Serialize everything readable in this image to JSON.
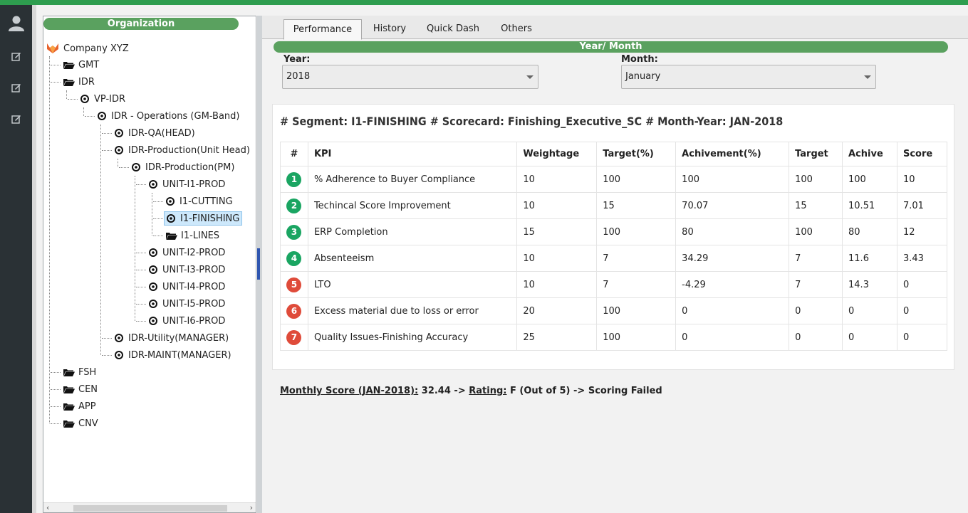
{
  "org_header": "Organization",
  "tree": {
    "root": "Company XYZ",
    "items": [
      {
        "label": "GMT"
      },
      {
        "label": "IDR"
      },
      {
        "label": "VP-IDR"
      },
      {
        "label": "IDR - Operations (GM-Band)"
      },
      {
        "label": "IDR-QA(HEAD)"
      },
      {
        "label": "IDR-Production(Unit Head)"
      },
      {
        "label": "IDR-Production(PM)"
      },
      {
        "label": "UNIT-I1-PROD"
      },
      {
        "label": "I1-CUTTING"
      },
      {
        "label": "I1-FINISHING"
      },
      {
        "label": "I1-LINES"
      },
      {
        "label": "UNIT-I2-PROD"
      },
      {
        "label": "UNIT-I3-PROD"
      },
      {
        "label": "UNIT-I4-PROD"
      },
      {
        "label": "UNIT-I5-PROD"
      },
      {
        "label": "UNIT-I6-PROD"
      },
      {
        "label": "IDR-Utility(MANAGER)"
      },
      {
        "label": "IDR-MAINT(MANAGER)"
      },
      {
        "label": "FSH"
      },
      {
        "label": "CEN"
      },
      {
        "label": "APP"
      },
      {
        "label": "CNV"
      }
    ],
    "selected": "I1-FINISHING"
  },
  "tabs": [
    "Performance",
    "History",
    "Quick Dash",
    "Others"
  ],
  "active_tab": "Performance",
  "year_month": {
    "header": "Year/ Month",
    "year_label": "Year:",
    "year_value": "2018",
    "month_label": "Month:",
    "month_value": "January"
  },
  "card": {
    "title": "# Segment: I1-FINISHING # Scorecard: Finishing_Executive_SC # Month-Year: JAN-2018",
    "columns": [
      "#",
      "KPI",
      "Weightage",
      "Target(%)",
      "Achivement(%)",
      "Target",
      "Achive",
      "Score"
    ],
    "rows": [
      {
        "n": "1",
        "status": "green",
        "kpi": "% Adherence to Buyer Compliance",
        "weightage": "10",
        "target_pct": "100",
        "achievement_pct": "100",
        "target": "100",
        "achive": "100",
        "score": "10"
      },
      {
        "n": "2",
        "status": "green",
        "kpi": "Techincal Score Improvement",
        "weightage": "10",
        "target_pct": "15",
        "achievement_pct": "70.07",
        "target": "15",
        "achive": "10.51",
        "score": "7.01"
      },
      {
        "n": "3",
        "status": "green",
        "kpi": "ERP Completion",
        "weightage": "15",
        "target_pct": "100",
        "achievement_pct": "80",
        "target": "100",
        "achive": "80",
        "score": "12"
      },
      {
        "n": "4",
        "status": "green",
        "kpi": "Absenteeism",
        "weightage": "10",
        "target_pct": "7",
        "achievement_pct": "34.29",
        "target": "7",
        "achive": "11.6",
        "score": "3.43"
      },
      {
        "n": "5",
        "status": "red",
        "kpi": "LTO",
        "weightage": "10",
        "target_pct": "7",
        "achievement_pct": "-4.29",
        "target": "7",
        "achive": "14.3",
        "score": "0"
      },
      {
        "n": "6",
        "status": "red",
        "kpi": "Excess material due to loss or error",
        "weightage": "20",
        "target_pct": "100",
        "achievement_pct": "0",
        "target": "0",
        "achive": "0",
        "score": "0"
      },
      {
        "n": "7",
        "status": "red",
        "kpi": "Quality Issues-Finishing Accuracy",
        "weightage": "25",
        "target_pct": "100",
        "achievement_pct": "0",
        "target": "0",
        "achive": "0",
        "score": "0"
      }
    ]
  },
  "summary": {
    "monthly_label": "Monthly Score (JAN-2018):",
    "monthly_value": " 32.44 -> ",
    "rating_label": "Rating:",
    "rating_value": " F (Out of 5) -> Scoring Failed"
  },
  "colors": {
    "green": "#1aa562",
    "red": "#df4b3a",
    "header_green": "#5aa15f",
    "top_bar": "#2e9d4f"
  },
  "icons": {
    "rail": [
      "user-icon",
      "edit-icon",
      "edit-icon",
      "edit-icon"
    ],
    "tree_root": "fox-logo-icon",
    "folder": "folder-open-icon",
    "target": "target-icon"
  }
}
